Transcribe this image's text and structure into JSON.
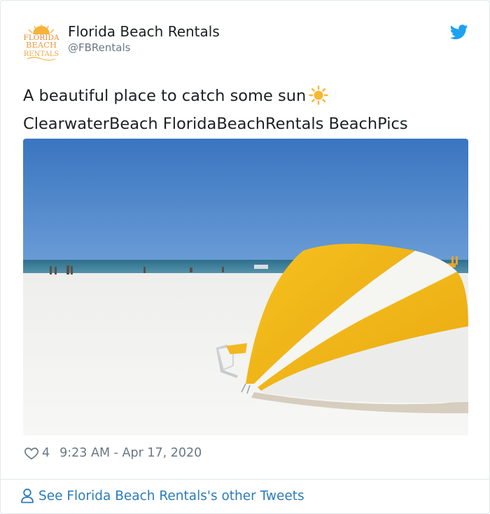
{
  "tweet": {
    "author": {
      "name": "Florida Beach Rentals",
      "handle": "@FBRentals",
      "avatar_text": [
        "FLORIDA",
        "BEACH",
        "RENTALS"
      ]
    },
    "text_line1": "A beautiful place to catch some sun",
    "hashtags": "ClearwaterBeach FloridaBeachRentals BeachPics",
    "likes": "4",
    "timestamp": "9:23 AM - Apr 17, 2020"
  },
  "footer": {
    "link_label": "See Florida Beach Rentals's other Tweets"
  },
  "icons": {
    "brand": "twitter-bird-icon",
    "emoji": "sun-icon",
    "like": "heart-icon",
    "profile": "person-icon"
  },
  "colors": {
    "twitter_blue": "#1da1f2",
    "link": "#2b7bb9",
    "muted": "#697882",
    "text": "#1c2022",
    "avatar_orange": "#f29a3a",
    "sun_yellow": "#f7b731"
  }
}
